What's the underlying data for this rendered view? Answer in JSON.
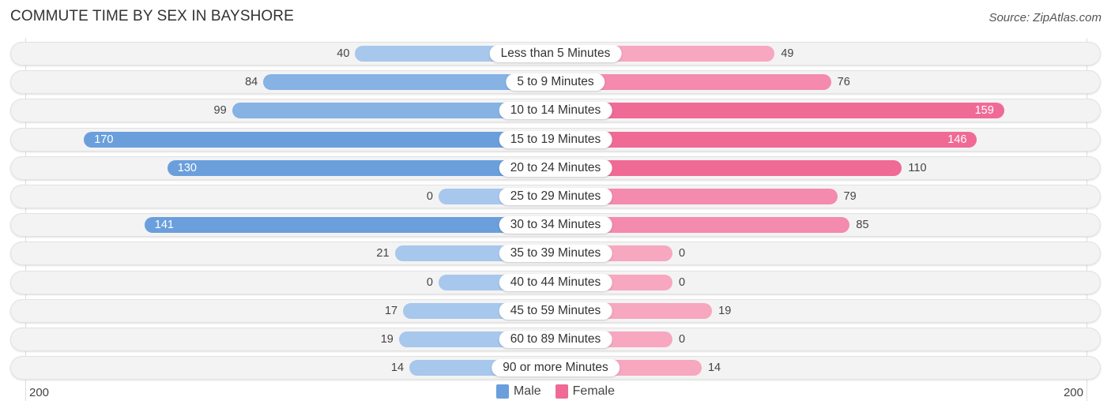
{
  "header": {
    "title": "COMMUTE TIME BY SEX IN BAYSHORE",
    "source": "Source: ZipAtlas.com"
  },
  "colors": {
    "male": "#6a9fdc",
    "male_light": "#a7c7ec",
    "female": "#f06a96",
    "female_light": "#f7a7c0"
  },
  "chart_data": {
    "type": "bar",
    "orientation": "horizontal-diverging",
    "title": "COMMUTE TIME BY SEX IN BAYSHORE",
    "categories": [
      "Less than 5 Minutes",
      "5 to 9 Minutes",
      "10 to 14 Minutes",
      "15 to 19 Minutes",
      "20 to 24 Minutes",
      "25 to 29 Minutes",
      "30 to 34 Minutes",
      "35 to 39 Minutes",
      "40 to 44 Minutes",
      "45 to 59 Minutes",
      "60 to 89 Minutes",
      "90 or more Minutes"
    ],
    "series": [
      {
        "name": "Male",
        "values": [
          40,
          84,
          99,
          170,
          130,
          0,
          141,
          21,
          0,
          17,
          19,
          14
        ]
      },
      {
        "name": "Female",
        "values": [
          49,
          76,
          159,
          146,
          110,
          79,
          85,
          0,
          0,
          19,
          0,
          14
        ]
      }
    ],
    "axis": {
      "left_label": "200",
      "right_label": "200",
      "range": [
        0,
        200
      ]
    },
    "legend": {
      "position": "bottom-center",
      "entries": [
        "Male",
        "Female"
      ]
    }
  }
}
